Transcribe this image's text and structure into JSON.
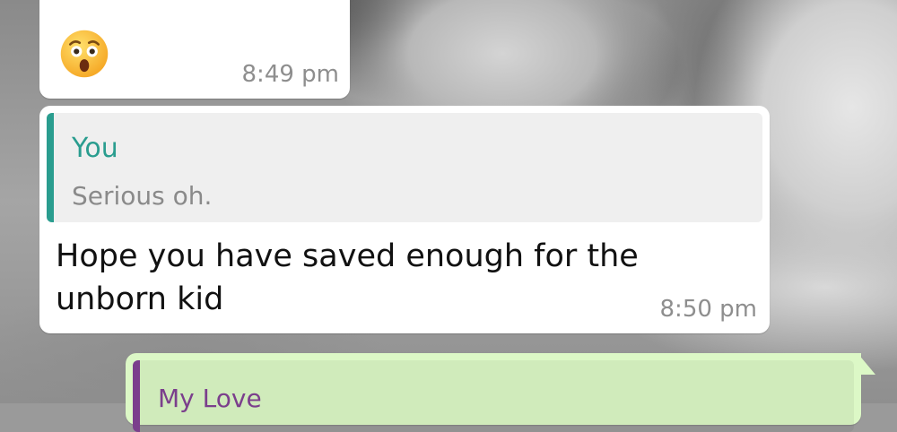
{
  "messages": [
    {
      "type": "incoming",
      "emoji": "astonished-face",
      "time": "8:49 pm"
    },
    {
      "type": "incoming",
      "reply_to": {
        "author": "You",
        "text": "Serious oh."
      },
      "text": "Hope you have saved enough for the unborn kid",
      "time": "8:50 pm"
    },
    {
      "type": "outgoing",
      "reply_to": {
        "author": "My Love"
      }
    }
  ],
  "colors": {
    "incoming_bubble": "#ffffff",
    "outgoing_bubble": "#dcf8c6",
    "quote_bar_you": "#2a9d8f",
    "quote_author_you": "#2a9d8f",
    "quote_bar_love": "#7b3f8c",
    "quote_author_love": "#7b3f8c",
    "timestamp": "#8e8e8e"
  }
}
